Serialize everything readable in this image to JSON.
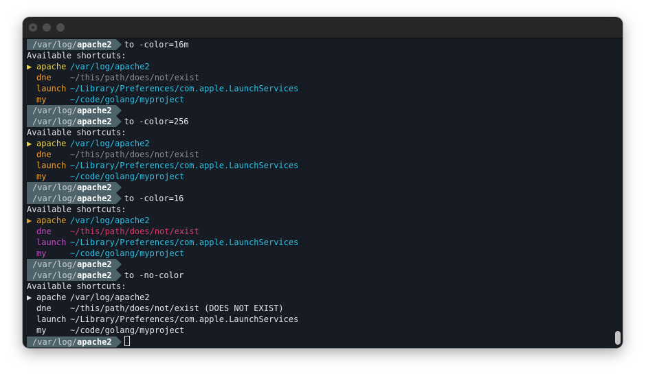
{
  "window": {
    "title_buttons": [
      "close-button",
      "minimize-button",
      "maximize-button"
    ]
  },
  "terminal": {
    "blocks": [
      {
        "prompt_dir": "/var/log/",
        "prompt_cur": "apache2",
        "command": "to -color=16m",
        "header": "Available shortcuts:",
        "shortcuts": [
          {
            "marker": "▶",
            "name": "apache",
            "path": "/var/log/apache2",
            "name_color": "#e5d14a",
            "path_color": "#30c1e0"
          },
          {
            "marker": "",
            "name": "dne",
            "path": "~/this/path/does/not/exist",
            "name_color": "#f0a030",
            "path_color": "#8e8e8e"
          },
          {
            "marker": "",
            "name": "launch",
            "path": "~/Library/Preferences/com.apple.LaunchServices",
            "name_color": "#f0a030",
            "path_color": "#30c1e0"
          },
          {
            "marker": "",
            "name": "my",
            "path": "~/code/golang/myproject",
            "name_color": "#f0a030",
            "path_color": "#30c1e0"
          }
        ],
        "marker_color": "#e5d14a",
        "after_prompt": {
          "prompt_dir": "/var/log/",
          "prompt_cur": "apache2"
        }
      },
      {
        "prompt_dir": "/var/log/",
        "prompt_cur": "apache2",
        "command": "to -color=256",
        "header": "Available shortcuts:",
        "shortcuts": [
          {
            "marker": "▶",
            "name": "apache",
            "path": "/var/log/apache2",
            "name_color": "#e5d14a",
            "path_color": "#30c1e0"
          },
          {
            "marker": "",
            "name": "dne",
            "path": "~/this/path/does/not/exist",
            "name_color": "#f0a030",
            "path_color": "#8e8e8e"
          },
          {
            "marker": "",
            "name": "launch",
            "path": "~/Library/Preferences/com.apple.LaunchServices",
            "name_color": "#f0a030",
            "path_color": "#30c1e0"
          },
          {
            "marker": "",
            "name": "my",
            "path": "~/code/golang/myproject",
            "name_color": "#f0a030",
            "path_color": "#30c1e0"
          }
        ],
        "marker_color": "#e5d14a",
        "after_prompt": {
          "prompt_dir": "/var/log/",
          "prompt_cur": "apache2"
        }
      },
      {
        "prompt_dir": "/var/log/",
        "prompt_cur": "apache2",
        "command": "to -color=16",
        "header": "Available shortcuts:",
        "shortcuts": [
          {
            "marker": "▶",
            "name": "apache",
            "path": "/var/log/apache2",
            "name_color": "#e0a030",
            "path_color": "#30c1e0"
          },
          {
            "marker": "",
            "name": "dne",
            "path": "~/this/path/does/not/exist",
            "name_color": "#c04ec0",
            "path_color": "#e03a6a"
          },
          {
            "marker": "",
            "name": "launch",
            "path": "~/Library/Preferences/com.apple.LaunchServices",
            "name_color": "#c04ec0",
            "path_color": "#30c1e0"
          },
          {
            "marker": "",
            "name": "my",
            "path": "~/code/golang/myproject",
            "name_color": "#c04ec0",
            "path_color": "#30c1e0"
          }
        ],
        "marker_color": "#e0a030",
        "after_prompt": {
          "prompt_dir": "/var/log/",
          "prompt_cur": "apache2"
        }
      },
      {
        "prompt_dir": "/var/log/",
        "prompt_cur": "apache2",
        "command": "to -no-color",
        "header": "Available shortcuts:",
        "shortcuts": [
          {
            "marker": "▶",
            "name": "apache",
            "path": "/var/log/apache2",
            "name_color": "#e6e6e6",
            "path_color": "#e6e6e6"
          },
          {
            "marker": "",
            "name": "dne",
            "path": "~/this/path/does/not/exist (DOES NOT EXIST)",
            "name_color": "#e6e6e6",
            "path_color": "#e6e6e6"
          },
          {
            "marker": "",
            "name": "launch",
            "path": "~/Library/Preferences/com.apple.LaunchServices",
            "name_color": "#e6e6e6",
            "path_color": "#e6e6e6"
          },
          {
            "marker": "",
            "name": "my",
            "path": "~/code/golang/myproject",
            "name_color": "#e6e6e6",
            "path_color": "#e6e6e6"
          }
        ],
        "marker_color": "#e6e6e6",
        "after_prompt": {
          "prompt_dir": "/var/log/",
          "prompt_cur": "apache2",
          "cursor": true
        }
      }
    ]
  },
  "colors": {
    "background": "#161b24",
    "prompt_bg": "#4e6369",
    "text": "#e6e6e6"
  }
}
